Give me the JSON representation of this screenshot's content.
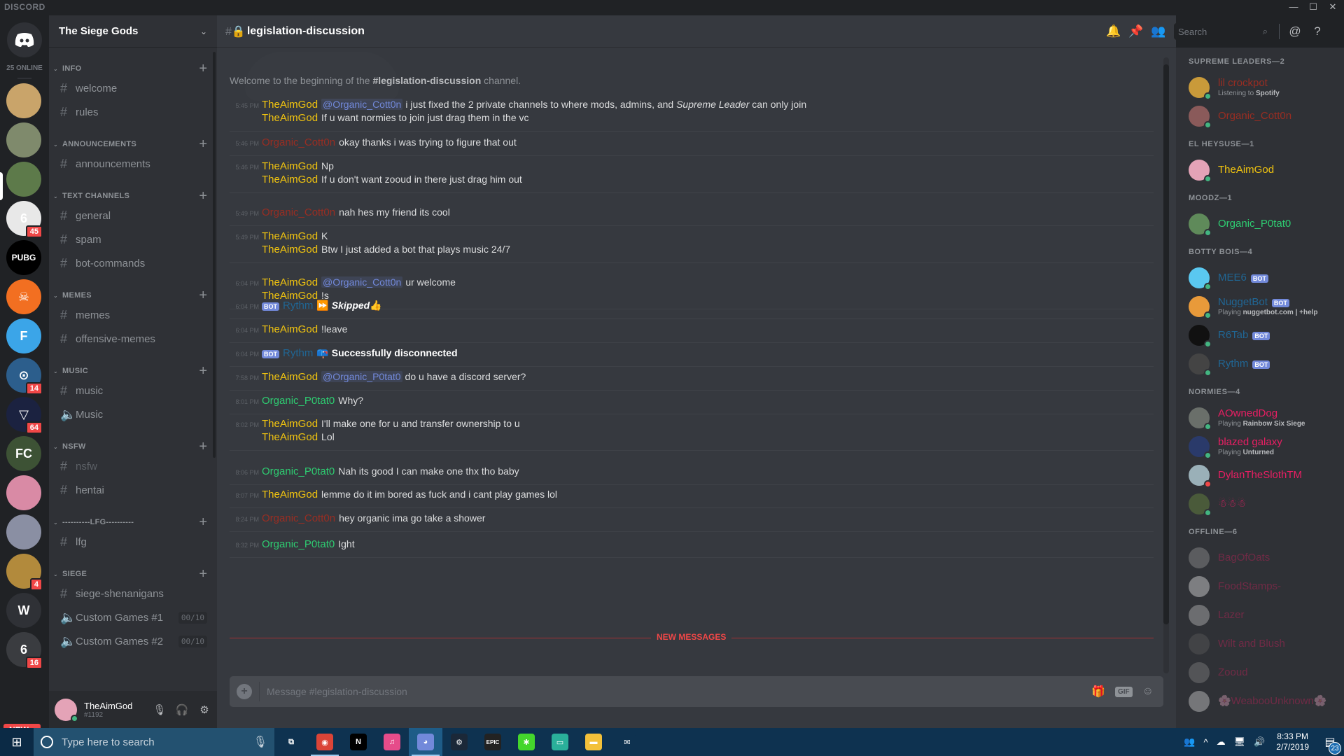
{
  "window": {
    "brand": "DISCORD",
    "controls": [
      "minimize",
      "maximize",
      "close"
    ]
  },
  "guilds": {
    "online_count": "25 ONLINE",
    "servers": [
      {
        "name": "potato-server",
        "color": "#c9a46a",
        "glyph": "",
        "badge": null
      },
      {
        "name": "cat-server",
        "color": "#7f8a6c",
        "glyph": "",
        "badge": null
      },
      {
        "name": "bunny-server",
        "color": "#5d7a4a",
        "glyph": "",
        "badge": null,
        "active": true
      },
      {
        "name": "rainbow-six-server",
        "color": "#e8e8e8",
        "glyph": "6",
        "badge": "45"
      },
      {
        "name": "pubg-server",
        "color": "#000000",
        "glyph": "PUBG",
        "badge": null
      },
      {
        "name": "division-server",
        "color": "#f26f21",
        "glyph": "☠",
        "badge": null
      },
      {
        "name": "fortnite-server",
        "color": "#3ba5e8",
        "glyph": "F",
        "badge": null
      },
      {
        "name": "pokemon-go-server",
        "color": "#2c5e8c",
        "glyph": "⊙",
        "badge": "14"
      },
      {
        "name": "dark-server",
        "color": "#1b2240",
        "glyph": "▽",
        "badge": "64"
      },
      {
        "name": "fc-server",
        "color": "#3d5235",
        "glyph": "FC",
        "badge": null
      },
      {
        "name": "pink-server",
        "color": "#d98aa5",
        "glyph": "",
        "badge": null
      },
      {
        "name": "headset-guy-server",
        "color": "#8a8fa3",
        "glyph": "",
        "badge": null
      },
      {
        "name": "lion-server",
        "color": "#b28a3c",
        "glyph": "",
        "badge": "4"
      },
      {
        "name": "w-server",
        "color": "#2f3136",
        "glyph": "W",
        "badge": null
      },
      {
        "name": "siege-6-server",
        "color": "#3a3c40",
        "glyph": "6",
        "badge": "16"
      }
    ],
    "new_pill": "NEW ↓"
  },
  "server": {
    "name": "The Siege Gods",
    "categories": [
      {
        "name": "INFO",
        "channels": [
          {
            "type": "text",
            "name": "welcome"
          },
          {
            "type": "text",
            "name": "rules"
          }
        ]
      },
      {
        "name": "ANNOUNCEMENTS",
        "channels": [
          {
            "type": "text",
            "name": "announcements"
          }
        ]
      },
      {
        "name": "TEXT CHANNELS",
        "channels": [
          {
            "type": "text",
            "name": "general"
          },
          {
            "type": "text",
            "name": "spam"
          },
          {
            "type": "text",
            "name": "bot-commands"
          }
        ]
      },
      {
        "name": "MEMES",
        "channels": [
          {
            "type": "text",
            "name": "memes"
          },
          {
            "type": "locked",
            "name": "offensive-memes"
          }
        ]
      },
      {
        "name": "MUSIC",
        "channels": [
          {
            "type": "text",
            "name": "music"
          },
          {
            "type": "voice",
            "name": "Music"
          }
        ]
      },
      {
        "name": "NSFW",
        "channels": [
          {
            "type": "locked",
            "name": "nsfw",
            "muted": true
          },
          {
            "type": "locked",
            "name": "hentai"
          }
        ]
      },
      {
        "name": "----------LFG----------",
        "channels": [
          {
            "type": "text",
            "name": "lfg"
          }
        ]
      },
      {
        "name": "SIEGE",
        "channels": [
          {
            "type": "text",
            "name": "siege-shenanigans"
          },
          {
            "type": "voice",
            "name": "Custom Games #1",
            "limit": "00/10"
          },
          {
            "type": "voice",
            "name": "Custom Games #2",
            "limit": "00/10"
          }
        ]
      }
    ]
  },
  "user": {
    "name": "TheAimGod",
    "tag": "#1192",
    "status": "online"
  },
  "channel": {
    "name": "legislation-discussion",
    "welcome_prefix": "Welcome to the beginning of the ",
    "welcome_channel": "#legislation-discussion",
    "welcome_suffix": " channel.",
    "search_placeholder": "Search",
    "composer_placeholder": "Message #legislation-discussion",
    "new_messages_label": "NEW MESSAGES"
  },
  "messages": [
    {
      "time": "5:45 PM",
      "lines": [
        {
          "author": "TheAimGod",
          "role": "aim",
          "mention": "@Organic_Cott0n",
          "text": "i just fixed the 2 private channels to where mods, admins, and ",
          "italic": "Supreme Leader",
          "after": " can only join"
        },
        {
          "author": "TheAimGod",
          "role": "aim",
          "text": "If u want normies to join just drag them in the vc"
        }
      ]
    },
    {
      "time": "5:46 PM",
      "lines": [
        {
          "author": "Organic_Cott0n",
          "role": "cot",
          "text": "okay thanks i was trying to figure that out"
        }
      ]
    },
    {
      "time": "5:46 PM",
      "lines": [
        {
          "author": "TheAimGod",
          "role": "aim",
          "text": "Np"
        },
        {
          "author": "TheAimGod",
          "role": "aim",
          "text": "If u don't want zooud in there just drag him out"
        }
      ]
    },
    {
      "time": "5:49 PM",
      "lines": [
        {
          "author": "Organic_Cott0n",
          "role": "cot",
          "text": "nah hes my friend its cool"
        }
      ]
    },
    {
      "time": "5:49 PM",
      "lines": [
        {
          "author": "TheAimGod",
          "role": "aim",
          "text": "K"
        },
        {
          "author": "TheAimGod",
          "role": "aim",
          "text": "Btw I just added a bot that plays music 24/7"
        }
      ]
    },
    {
      "time": "6:04 PM",
      "lines": [
        {
          "author": "TheAimGod",
          "role": "aim",
          "mention": "@Organic_Cott0n",
          "text": "ur welcome"
        },
        {
          "author": "TheAimGod",
          "role": "aim",
          "text": "!s"
        }
      ]
    },
    {
      "time": "6:04 PM",
      "lines": [
        {
          "author": "Rythm",
          "role": "bot",
          "bot": "BOT",
          "emoji": "⏩",
          "bold_italic": "Skipped",
          "emoji2": "👍"
        }
      ]
    },
    {
      "time": "6:04 PM",
      "lines": [
        {
          "author": "TheAimGod",
          "role": "aim",
          "text": "!leave"
        }
      ]
    },
    {
      "time": "6:04 PM",
      "lines": [
        {
          "author": "Rythm",
          "role": "bot",
          "bot": "BOT",
          "emoji": "📪",
          "bold": "Successfully disconnected"
        }
      ]
    },
    {
      "time": "7:58 PM",
      "lines": [
        {
          "author": "TheAimGod",
          "role": "aim",
          "mention": "@Organic_P0tat0",
          "text": "do u have a discord server?"
        }
      ]
    },
    {
      "time": "8:01 PM",
      "lines": [
        {
          "author": "Organic_P0tat0",
          "role": "pot",
          "text": "Why?"
        }
      ]
    },
    {
      "time": "8:02 PM",
      "lines": [
        {
          "author": "TheAimGod",
          "role": "aim",
          "text": "I'll make one for u and transfer ownership to u"
        },
        {
          "author": "TheAimGod",
          "role": "aim",
          "text": "Lol"
        }
      ]
    },
    {
      "time": "8:06 PM",
      "lines": [
        {
          "author": "Organic_P0tat0",
          "role": "pot",
          "text": "Nah its good I can make one thx tho baby"
        }
      ]
    },
    {
      "time": "8:07 PM",
      "lines": [
        {
          "author": "TheAimGod",
          "role": "aim",
          "text": "lemme do it im bored as fuck and i cant play games lol"
        }
      ]
    },
    {
      "time": "8:24 PM",
      "lines": [
        {
          "author": "Organic_Cott0n",
          "role": "cot",
          "text": "hey organic ima go take a shower"
        }
      ]
    },
    {
      "time": "8:32 PM",
      "lines": [
        {
          "author": "Organic_P0tat0",
          "role": "pot",
          "text": "Ight"
        }
      ]
    }
  ],
  "members": [
    {
      "group": "SUPREME LEADERS—2",
      "list": [
        {
          "name": "lil crockpot",
          "color": "#992d22",
          "status": "online",
          "activity_prefix": "Listening to ",
          "activity": "Spotify",
          "av": "#c99a3a"
        },
        {
          "name": "Organic_Cott0n",
          "color": "#992d22",
          "status": "online",
          "av": "#8a5a5a"
        }
      ]
    },
    {
      "group": "EL HEYSUSE—1",
      "list": [
        {
          "name": "TheAimGod",
          "color": "#f1c40f",
          "status": "online",
          "av": "#e4a3b7"
        }
      ]
    },
    {
      "group": "MOODZ—1",
      "list": [
        {
          "name": "Organic_P0tat0",
          "color": "#2ecc71",
          "status": "online",
          "av": "#5f8a5a"
        }
      ]
    },
    {
      "group": "BOTTY BOIS—4",
      "list": [
        {
          "name": "MEE6",
          "color": "#206694",
          "status": "online",
          "bot": "BOT",
          "av": "#5ac8f0"
        },
        {
          "name": "NuggetBot",
          "color": "#206694",
          "status": "online",
          "bot": "BOT",
          "activity_prefix": "Playing ",
          "activity": "nuggetbot.com | +help",
          "av": "#e89a3a"
        },
        {
          "name": "R6Tab",
          "color": "#206694",
          "status": "online",
          "bot": "BOT",
          "av": "#111111"
        },
        {
          "name": "Rythm",
          "color": "#206694",
          "status": "online",
          "bot": "BOT",
          "av": "#444444"
        }
      ]
    },
    {
      "group": "NORMIES—4",
      "list": [
        {
          "name": "AOwnedDog",
          "color": "#e91e63",
          "status": "online",
          "activity_prefix": "Playing ",
          "activity": "Rainbow Six Siege",
          "av": "#6a6f6a"
        },
        {
          "name": "blazed galaxy",
          "color": "#e91e63",
          "status": "online",
          "activity_prefix": "Playing ",
          "activity": "Unturned",
          "av": "#2a3a6a"
        },
        {
          "name": "DylanTheSlothTM",
          "color": "#e91e63",
          "status": "dnd",
          "av": "#9ab0b8"
        },
        {
          "name": "☃☃☃",
          "color": "#e91e63",
          "status": "online",
          "av": "#4a5a3a"
        }
      ]
    },
    {
      "group": "OFFLINE—6",
      "list": [
        {
          "name": "BagOfOats",
          "color": "#e91e63",
          "status": "offline",
          "av": "#888888"
        },
        {
          "name": "FoodStamps-",
          "color": "#e91e63",
          "status": "offline",
          "av": "#cccccc"
        },
        {
          "name": "Lazer",
          "color": "#e91e63",
          "status": "offline",
          "av": "#aaaaaa"
        },
        {
          "name": "Wilt and Blush",
          "color": "#e91e63",
          "status": "offline",
          "av": "#555555"
        },
        {
          "name": "Zooud",
          "color": "#e91e63",
          "status": "offline",
          "av": "#777777"
        },
        {
          "name": "🌸WeabooUnknown🌸",
          "color": "#e91e63",
          "status": "offline",
          "av": "#bbbbbb"
        }
      ]
    }
  ],
  "status_colors": {
    "online": "#43b581",
    "dnd": "#f04747",
    "offline": "transparent"
  },
  "taskbar": {
    "search_placeholder": "Type here to search",
    "apps": [
      {
        "name": "task-view",
        "glyph": "⧉",
        "color": "transparent"
      },
      {
        "name": "chrome",
        "glyph": "◉",
        "color": "#db4437",
        "running": true
      },
      {
        "name": "netflix",
        "glyph": "N",
        "color": "#000000"
      },
      {
        "name": "itunes",
        "glyph": "♫",
        "color": "#e64c8a"
      },
      {
        "name": "discord",
        "glyph": "◕",
        "color": "#7289da",
        "active": true
      },
      {
        "name": "steam",
        "glyph": "⚙",
        "color": "#1b2838"
      },
      {
        "name": "epic-games",
        "glyph": "EPIC",
        "color": "#222222"
      },
      {
        "name": "razer",
        "glyph": "✱",
        "color": "#44d62c"
      },
      {
        "name": "gaming-app",
        "glyph": "▭",
        "color": "#2ab09a"
      },
      {
        "name": "file-explorer",
        "glyph": "▬",
        "color": "#f3c13a"
      },
      {
        "name": "mail",
        "glyph": "✉",
        "color": "#0e3250"
      }
    ],
    "time": "8:33 PM",
    "date": "2/7/2019",
    "notifications": "23"
  }
}
